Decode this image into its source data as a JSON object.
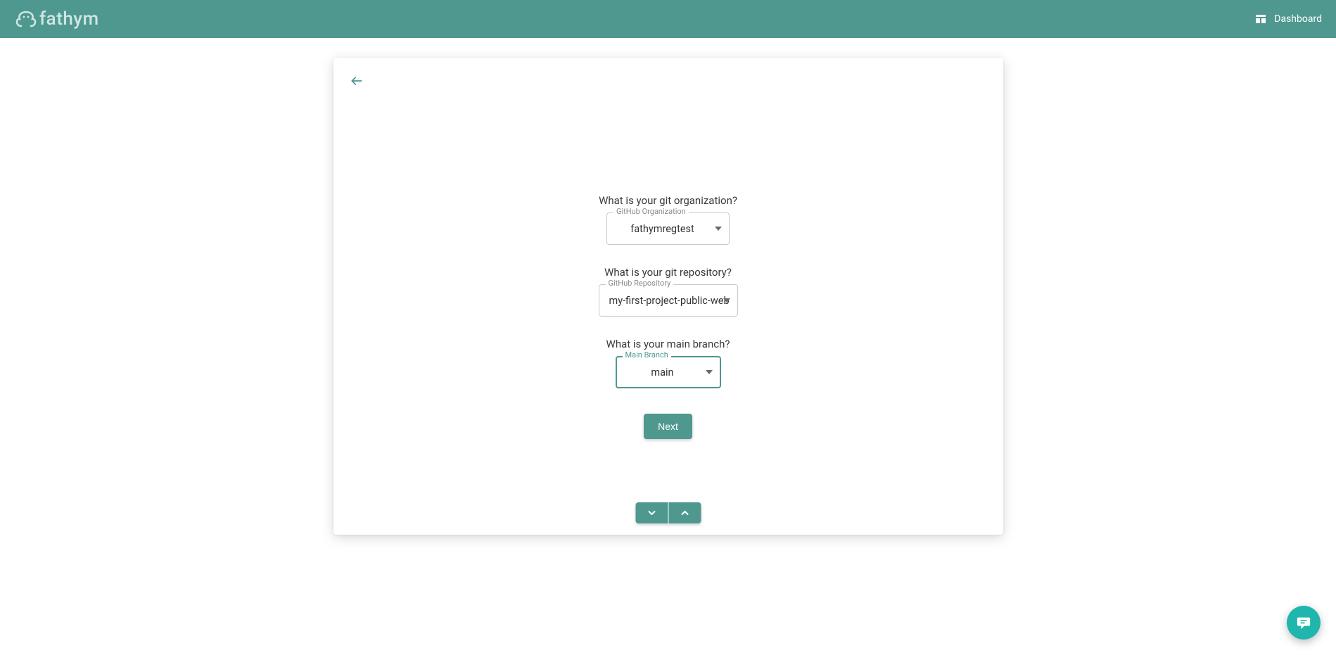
{
  "header": {
    "brand": "fathym",
    "dashboard_label": "Dashboard"
  },
  "form": {
    "org": {
      "question": "What is your git organization?",
      "label": "GitHub Organization",
      "value": "fathymregtest"
    },
    "repo": {
      "question": "What is your git repository?",
      "label": "GitHub Repository",
      "value": "my-first-project-public-web"
    },
    "branch": {
      "question": "What is your main branch?",
      "label": "Main Branch",
      "value": "main"
    },
    "next_label": "Next"
  },
  "colors": {
    "primary": "#4e9890",
    "chat": "#1fb6ad"
  }
}
